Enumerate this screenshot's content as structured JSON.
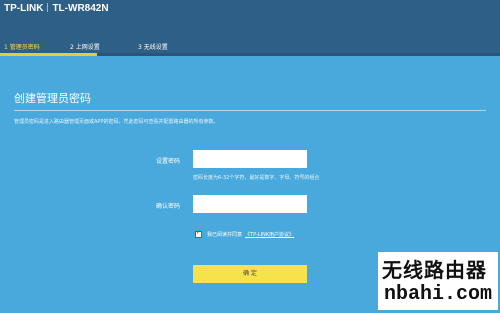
{
  "header": {
    "brand": "TP-LINK",
    "model": "TL-WR842N"
  },
  "steps": [
    {
      "label": "1 管理员密码",
      "active": true
    },
    {
      "label": "2 上网设置",
      "active": false
    },
    {
      "label": "3 无线设置",
      "active": false
    }
  ],
  "progress": {
    "fraction": 0.0
  },
  "form": {
    "heading": "创建管理员密码",
    "description": "管理员密码是进入路由器管理页面或APP的密码，凭此密码可查看并配置路由器的所有参数。",
    "password_label": "设置密码",
    "password_value": "",
    "password_hint": "密码长度为6-32个字符，最好是数字、字母、符号的组合",
    "confirm_label": "确认密码",
    "confirm_value": "",
    "agree_checked": true,
    "agree_text": "我已阅读并同意",
    "agree_link": "《TP-LINK用户协议》",
    "confirm_button": "确 定"
  },
  "watermark": {
    "line1": "无线路由器",
    "line2": "nbahi.com"
  },
  "colors": {
    "background": "#4aa9dc",
    "topbar": "#2e5f86",
    "accent": "#f3c640",
    "button": "#f6e24a"
  }
}
